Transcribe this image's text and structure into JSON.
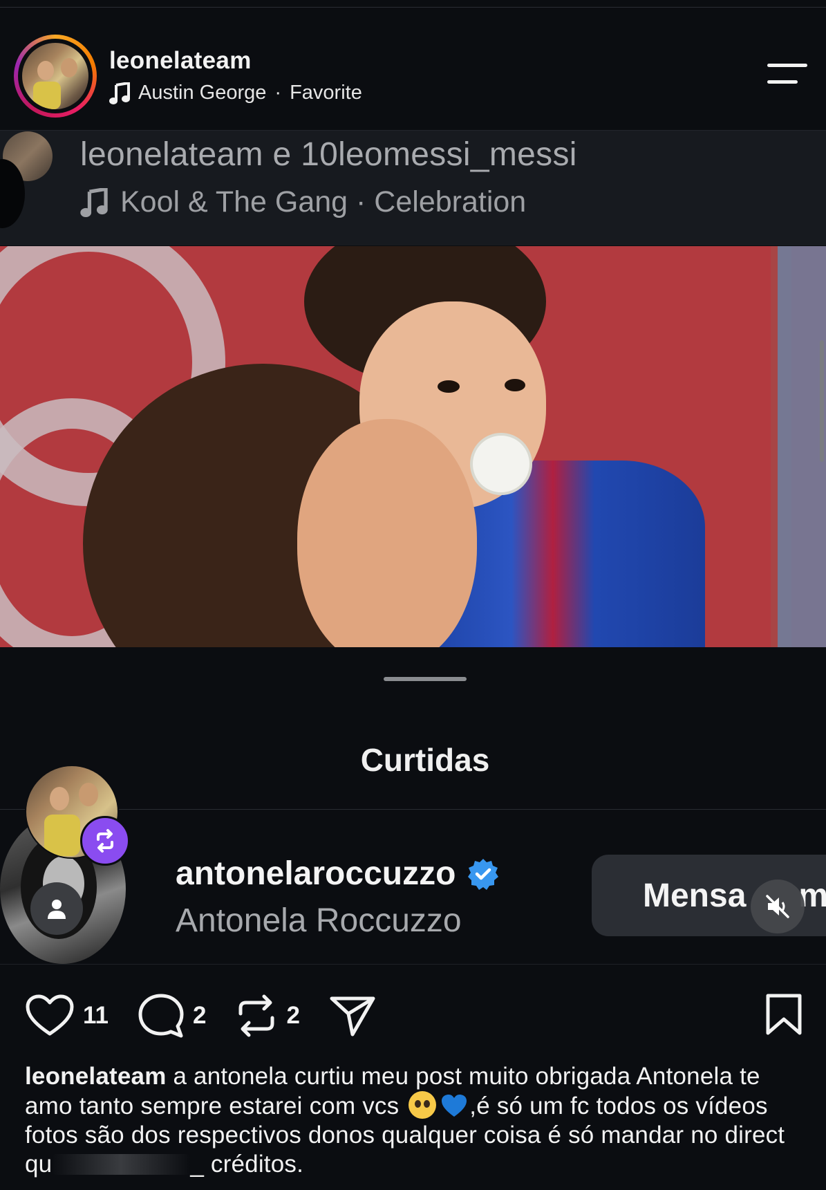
{
  "header": {
    "username": "leonelateam",
    "music_artist": "Austin George",
    "music_separator": "·",
    "music_title": "Favorite",
    "menu_icon": "hamburger-menu-icon"
  },
  "reshared_post": {
    "users": "leonelateam e 10leomessi_messi",
    "music": "Kool & The Gang · Celebration"
  },
  "likes_sheet": {
    "title": "Curtidas",
    "liker_username": "antonelaroccuzzo",
    "liker_fullname": "Antonela Roccuzzo",
    "message_button": "Mensa",
    "message_button_tail": "m",
    "verified_color": "#3897f0"
  },
  "actions": {
    "likes": "11",
    "comments": "2",
    "reposts": "2"
  },
  "caption": {
    "username": "leonelateam",
    "text_part1": " a antonela curtiu meu post muito obrigada Antonela te amo tanto sempre estarei com vcs ",
    "text_part2": ",é só um fc todos os vídeos fotos são dos respectivos donos qualquer coisa é só mandar no direct qu",
    "text_part3": "_ créditos."
  },
  "colors": {
    "background": "#0b0d11",
    "repost_badge": "#8a4cf0"
  }
}
